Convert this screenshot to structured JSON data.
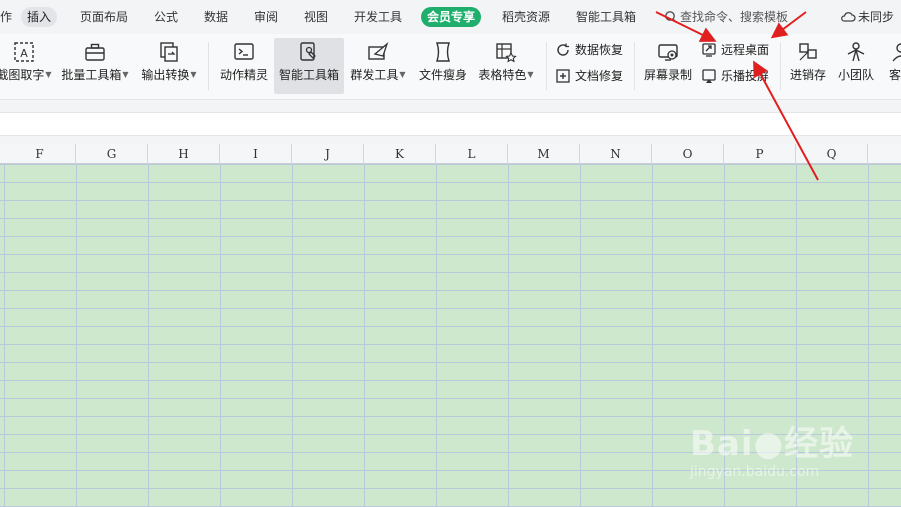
{
  "menubar": {
    "items": [
      {
        "label": "作"
      },
      {
        "label": "插入",
        "active": true
      },
      {
        "label": "页面布局"
      },
      {
        "label": "公式"
      },
      {
        "label": "数据"
      },
      {
        "label": "审阅"
      },
      {
        "label": "视图"
      },
      {
        "label": "开发工具"
      },
      {
        "label": "会员专享",
        "vip": true
      },
      {
        "label": "稻壳资源"
      },
      {
        "label": "智能工具箱"
      }
    ],
    "search_placeholder": "查找命令、搜索模板",
    "sync_label": "未同步"
  },
  "ribbon": {
    "tools": [
      {
        "label": "截图取字",
        "dropdown": true,
        "icon": "text-scan-icon"
      },
      {
        "label": "批量工具箱",
        "dropdown": true,
        "icon": "toolbox-icon"
      },
      {
        "label": "输出转换",
        "dropdown": true,
        "icon": "convert-icon"
      },
      {
        "label": "动作精灵",
        "icon": "terminal-icon"
      },
      {
        "label": "智能工具箱",
        "icon": "smart-tool-icon",
        "selected": true
      },
      {
        "label": "群发工具",
        "dropdown": true,
        "icon": "send-icon"
      },
      {
        "label": "文件瘦身",
        "icon": "slim-file-icon"
      },
      {
        "label": "表格特色",
        "dropdown": true,
        "icon": "table-feature-icon"
      },
      {
        "label": "屏幕录制",
        "icon": "screen-record-icon"
      },
      {
        "label": "进销存",
        "icon": "inventory-icon"
      },
      {
        "label": "小团队",
        "icon": "team-icon"
      },
      {
        "label": "客户",
        "icon": "customer-icon"
      }
    ],
    "small_tools": [
      {
        "label": "数据恢复",
        "icon": "data-restore-icon"
      },
      {
        "label": "文档修复",
        "icon": "doc-repair-icon"
      },
      {
        "label": "远程桌面",
        "icon": "remote-desktop-icon"
      },
      {
        "label": "乐播投屏",
        "icon": "cast-screen-icon"
      }
    ]
  },
  "columns": [
    "F",
    "G",
    "H",
    "I",
    "J",
    "K",
    "L",
    "M",
    "N",
    "O",
    "P",
    "Q"
  ],
  "colors": {
    "vip": "#1fae6c",
    "grid": "#cde8cc",
    "arrow": "#e02020"
  },
  "watermark": {
    "brand": "Bai●经验",
    "site": "jingyan.baidu.com"
  }
}
